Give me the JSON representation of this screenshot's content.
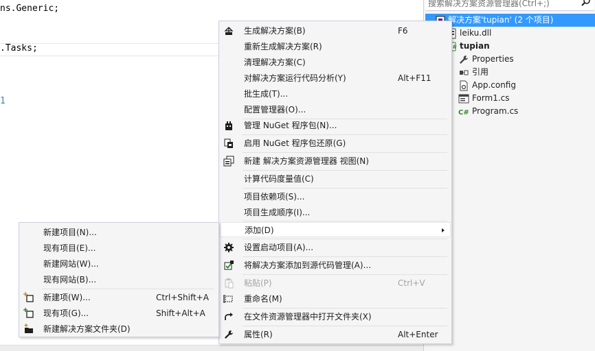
{
  "editor": {
    "code_lines": [
      "ns.Generic;",
      ".Tasks;"
    ],
    "line_marker": "1"
  },
  "explorer": {
    "search_placeholder": "搜索解决方案资源管理器(Ctrl+;)",
    "items": [
      {
        "label": "解决方案'tupian' (2 个项目)",
        "icon": "solution-icon"
      },
      {
        "label": "leiku.dll",
        "icon": "dll-icon"
      },
      {
        "label": "tupian",
        "icon": "csharp-project-icon"
      },
      {
        "label": "Properties",
        "icon": "wrench-icon"
      },
      {
        "label": "引用",
        "icon": "references-icon"
      },
      {
        "label": "App.config",
        "icon": "config-file-icon"
      },
      {
        "label": "Form1.cs",
        "icon": "form-icon"
      },
      {
        "label": "Program.cs",
        "icon": "csharp-file-icon"
      }
    ]
  },
  "context_menu": {
    "items": [
      {
        "label": "生成解决方案(B)",
        "shortcut": "F6",
        "icon": "build-icon"
      },
      {
        "label": "重新生成解决方案(R)",
        "shortcut": ""
      },
      {
        "label": "清理解决方案(C)",
        "shortcut": ""
      },
      {
        "label": "对解决方案运行代码分析(Y)",
        "shortcut": "Alt+F11"
      },
      {
        "label": "批生成(T)...",
        "shortcut": ""
      },
      {
        "label": "配置管理器(O)...",
        "shortcut": ""
      },
      {
        "label": "管理 NuGet 程序包(N)...",
        "shortcut": "",
        "icon": "nuget-icon"
      },
      {
        "label": "启用 NuGet 程序包还原(G)",
        "shortcut": "",
        "icon": "nuget-restore-icon"
      },
      {
        "label": "新建 解决方案资源管理器 视图(N)",
        "shortcut": "",
        "icon": "new-view-icon"
      },
      {
        "label": "计算代码度量值(C)",
        "shortcut": ""
      },
      {
        "label": "项目依赖项(S)...",
        "shortcut": ""
      },
      {
        "label": "项目生成顺序(I)...",
        "shortcut": ""
      },
      {
        "label": "添加(D)",
        "shortcut": ""
      },
      {
        "label": "设置启动项目(A)...",
        "shortcut": "",
        "icon": "gear-icon"
      },
      {
        "label": "将解决方案添加到源代码管理(A)...",
        "shortcut": "",
        "icon": "source-control-icon"
      },
      {
        "label": "粘贴(P)",
        "shortcut": "Ctrl+V",
        "icon": "paste-icon"
      },
      {
        "label": "重命名(M)",
        "shortcut": "",
        "icon": "rename-icon"
      },
      {
        "label": "在文件资源管理器中打开文件夹(X)",
        "shortcut": "",
        "icon": "open-folder-icon"
      },
      {
        "label": "属性(R)",
        "shortcut": "Alt+Enter",
        "icon": "wrench-icon"
      }
    ]
  },
  "add_submenu": {
    "items": [
      {
        "label": "新建项目(N)...",
        "shortcut": ""
      },
      {
        "label": "现有项目(E)...",
        "shortcut": ""
      },
      {
        "label": "新建网站(W)...",
        "shortcut": ""
      },
      {
        "label": "现有网站(B)...",
        "shortcut": ""
      },
      {
        "label": "新建项(W)...",
        "shortcut": "Ctrl+Shift+A",
        "icon": "new-item-icon"
      },
      {
        "label": "现有项(G)...",
        "shortcut": "Shift+Alt+A",
        "icon": "existing-item-icon"
      },
      {
        "label": "新建解决方案文件夹(D)",
        "shortcut": "",
        "icon": "new-folder-icon"
      }
    ]
  }
}
